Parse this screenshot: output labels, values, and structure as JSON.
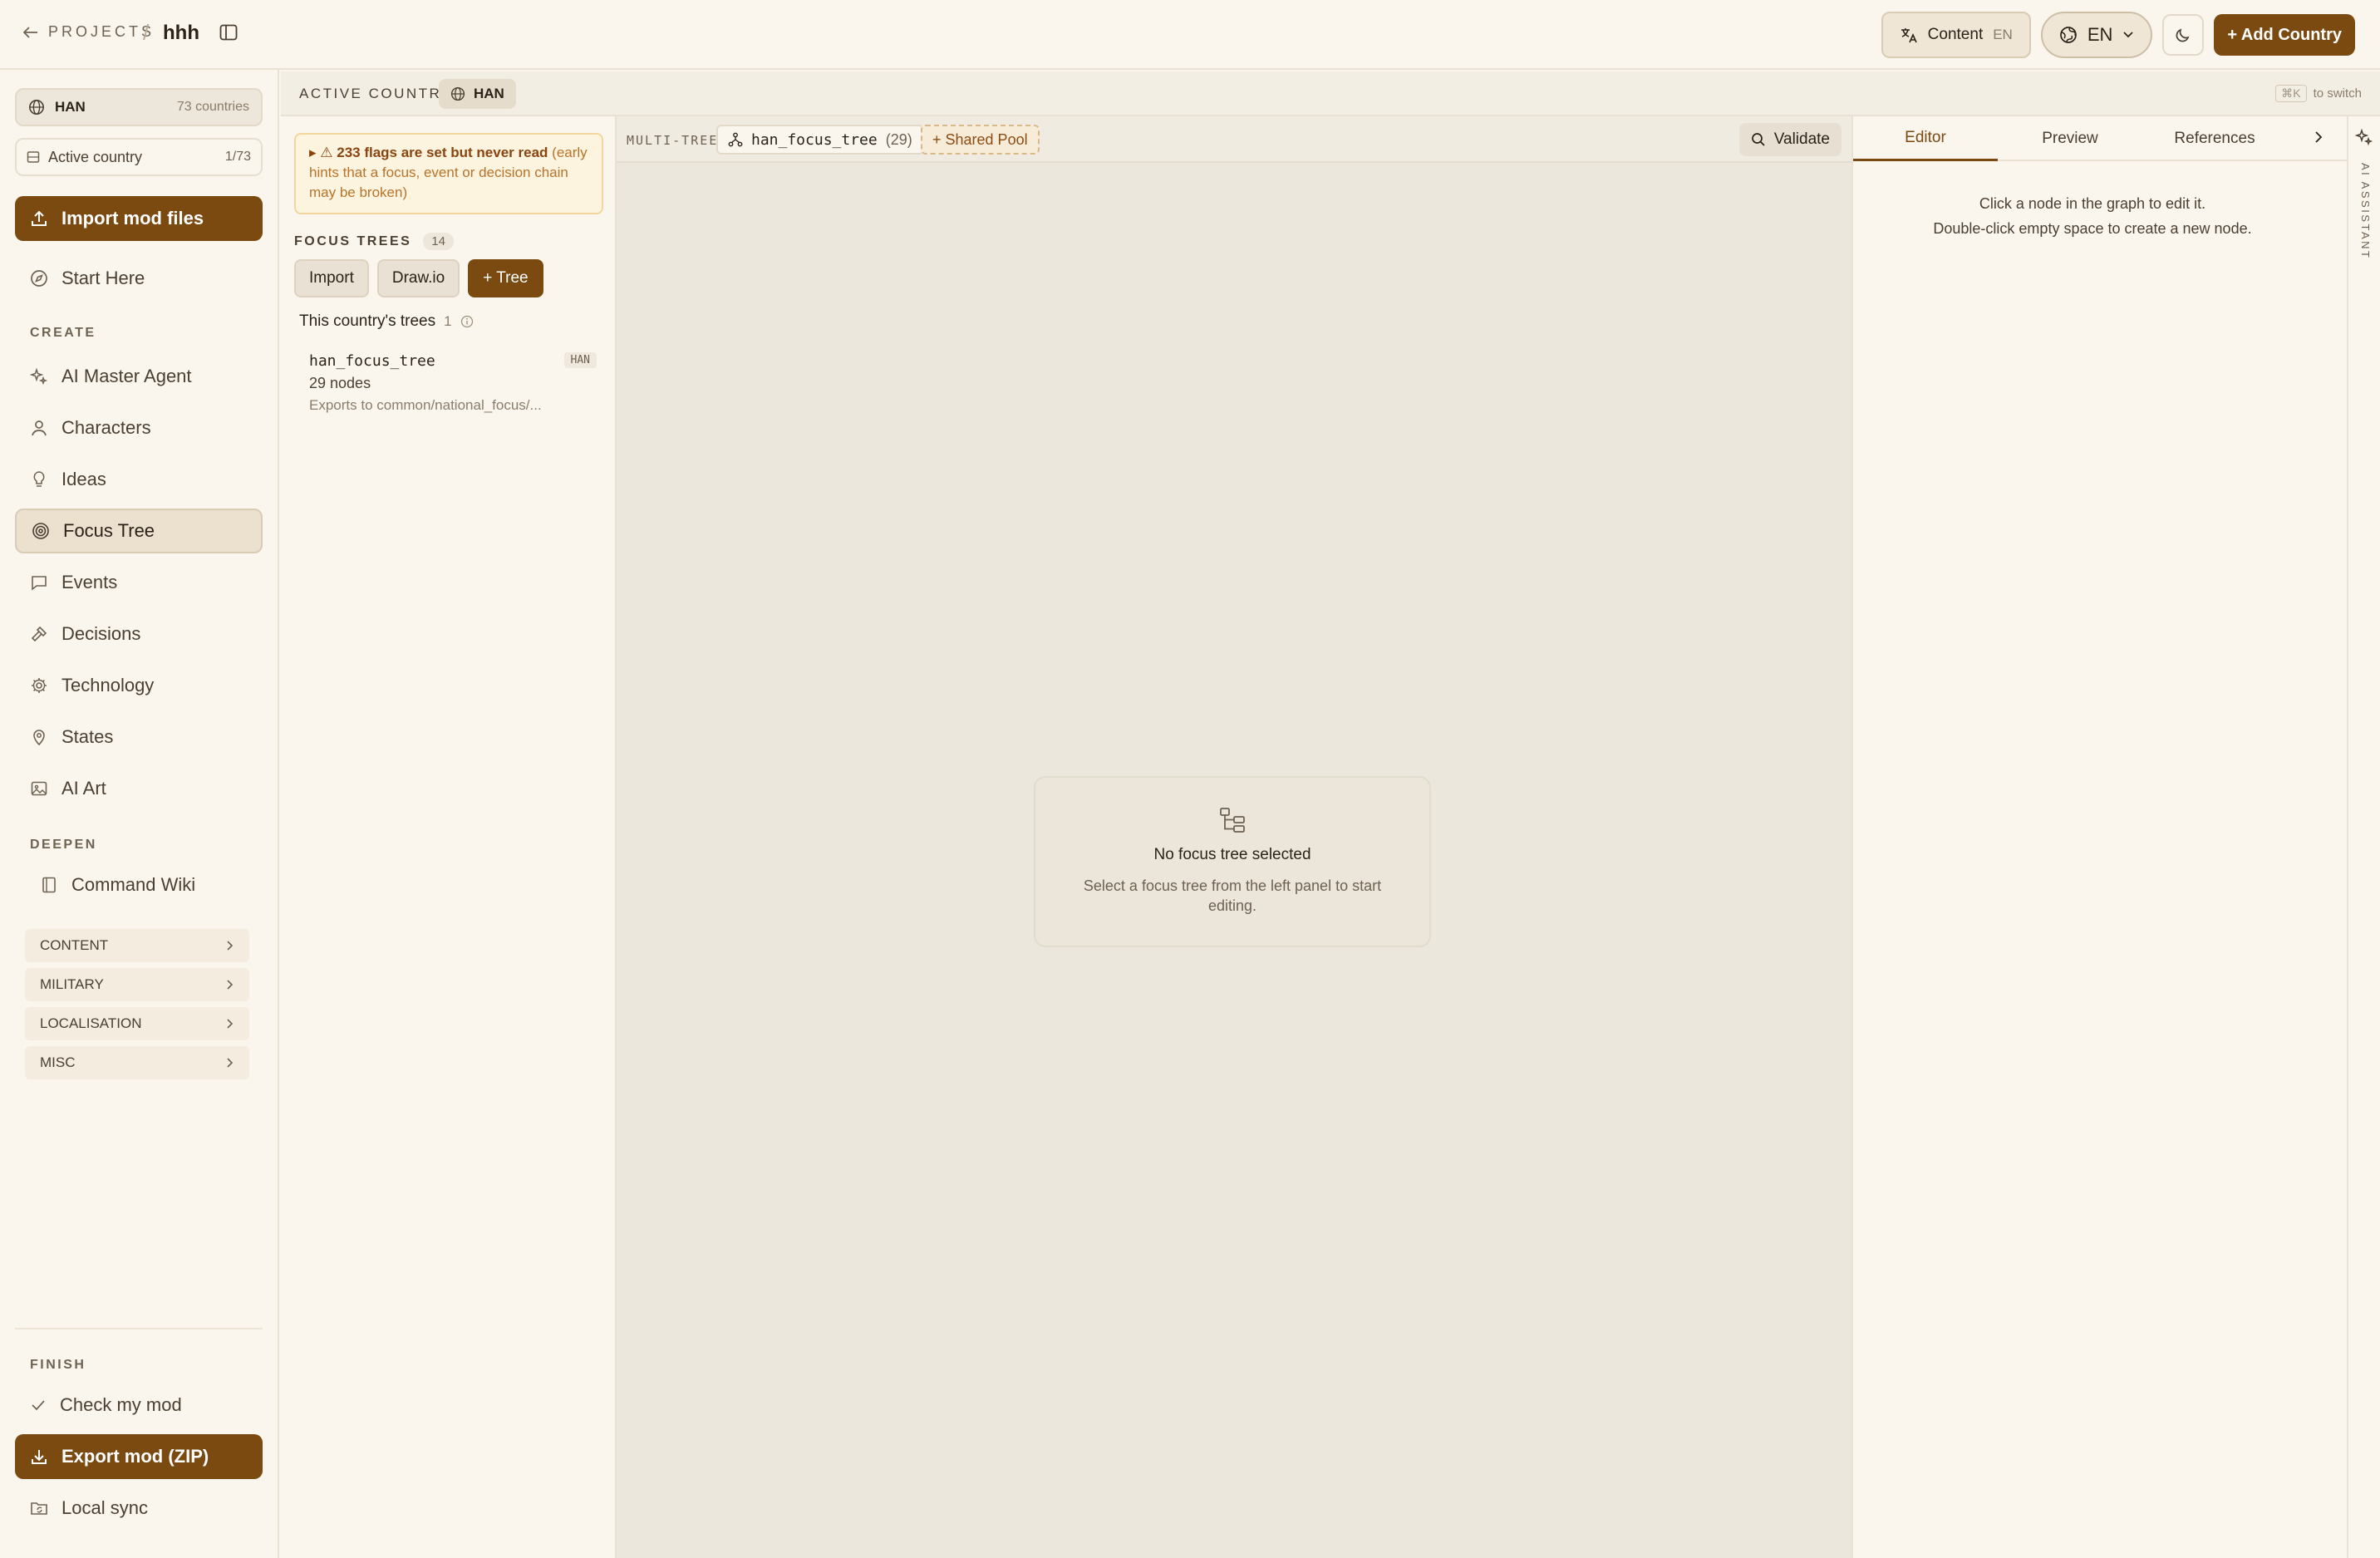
{
  "topbar": {
    "back_label": "PROJECTS",
    "separator": "/",
    "project_name": "hhh",
    "content_button": {
      "label": "Content",
      "code": "EN"
    },
    "language_button": {
      "label": "EN"
    },
    "add_country_label": "+ Add Country"
  },
  "sidebar": {
    "country_selector": {
      "code": "HAN",
      "count": "73 countries"
    },
    "active_country": {
      "label": "Active country",
      "count": "1/73"
    },
    "import_label": "Import mod files",
    "start_here_label": "Start Here",
    "create_label": "CREATE",
    "create_items": [
      {
        "label": "AI Master Agent",
        "icon": "sparkle-icon"
      },
      {
        "label": "Characters",
        "icon": "user-icon"
      },
      {
        "label": "Ideas",
        "icon": "lightbulb-icon"
      },
      {
        "label": "Focus Tree",
        "icon": "target-icon",
        "active": true
      },
      {
        "label": "Events",
        "icon": "message-icon"
      },
      {
        "label": "Decisions",
        "icon": "gavel-icon"
      },
      {
        "label": "Technology",
        "icon": "gear-icon"
      },
      {
        "label": "States",
        "icon": "map-pin-icon"
      },
      {
        "label": "AI Art",
        "icon": "image-icon"
      }
    ],
    "deepen_label": "DEEPEN",
    "command_wiki_label": "Command Wiki",
    "groups": [
      "CONTENT",
      "MILITARY",
      "LOCALISATION",
      "MISC"
    ],
    "finish_label": "FINISH",
    "check_mod_label": "Check my mod",
    "export_label": "Export mod (ZIP)",
    "local_sync_label": "Local sync"
  },
  "country_bar": {
    "label": "ACTIVE COUNTRY",
    "country_code": "HAN",
    "shortcut": "⌘K",
    "switch_hint": "to switch"
  },
  "trees_panel": {
    "warning": {
      "headline": "233 flags are set but never read",
      "detail": "(early hints that a focus, event or decision chain may be broken)"
    },
    "focus_trees_label": "FOCUS TREES",
    "focus_trees_count": "14",
    "import_button": "Import",
    "drawio_button": "Draw.io",
    "new_tree_button": "+ Tree",
    "country_trees_label": "This country's trees",
    "country_trees_count": "1",
    "trees": [
      {
        "name": "han_focus_tree",
        "tag": "HAN",
        "nodes": "29 nodes",
        "path": "Exports to common/national_focus/..."
      }
    ]
  },
  "canvas": {
    "multi_tree_label": "MULTI-TREE",
    "tree_chip_name": "han_focus_tree",
    "tree_chip_count": "(29)",
    "shared_pool_label": "+ Shared Pool",
    "validate_label": "Validate",
    "empty_title": "No focus tree selected",
    "empty_desc": "Select a focus tree from the left panel to start editing."
  },
  "editor": {
    "tabs": [
      "Editor",
      "Preview",
      "References"
    ],
    "hint_line1": "Click a node in the graph to edit it.",
    "hint_line2": "Double-click empty space to create a new node."
  },
  "ai_rail": {
    "label": "AI ASSISTANT"
  },
  "colors": {
    "accent": "#7a4a10",
    "background": "#faf6ee",
    "canvas": "#ece7dd",
    "warning_bg": "#fdf4df",
    "warning_text": "#b8732a"
  }
}
